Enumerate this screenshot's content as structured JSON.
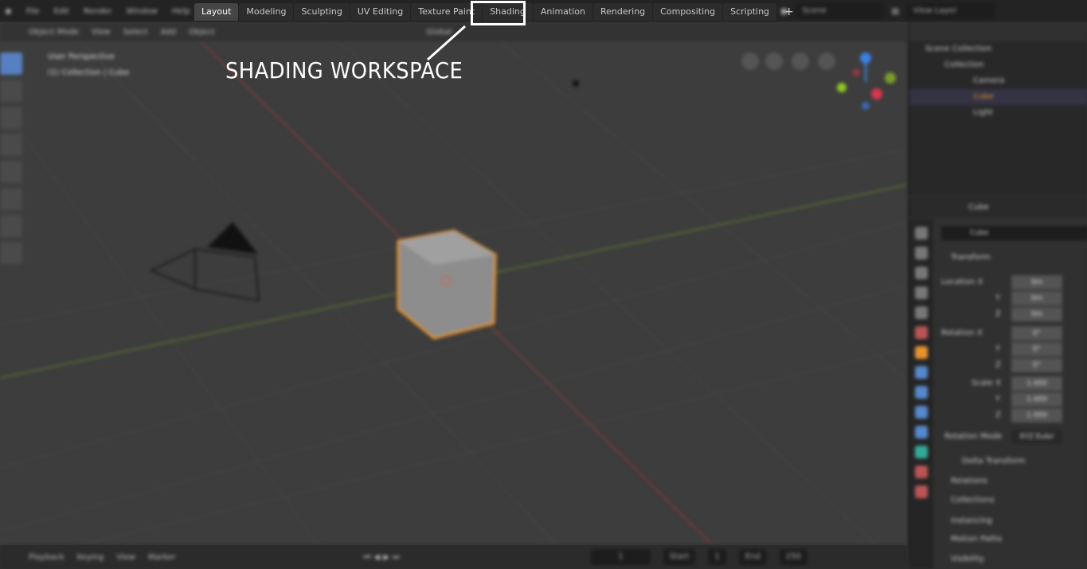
{
  "menu": [
    "File",
    "Edit",
    "Render",
    "Window",
    "Help"
  ],
  "workspace_tabs": [
    "Layout",
    "Modeling",
    "Sculpting",
    "UV Editing",
    "Texture Paint",
    "Shading",
    "Animation",
    "Rendering",
    "Compositing",
    "Scripting"
  ],
  "add_tab": "+",
  "active_tab": "Layout",
  "scene": "Scene",
  "view_layer": "View Layer",
  "viewport_header": {
    "mode": "Object Mode",
    "menus": [
      "View",
      "Select",
      "Add",
      "Object"
    ],
    "orientation": "Global"
  },
  "viewport_info": {
    "line1": "User Perspective",
    "line2": "(1) Collection | Cube"
  },
  "outliner": {
    "items": [
      "Scene Collection",
      "Collection",
      "Camera",
      "Cube",
      "Light"
    ]
  },
  "properties": {
    "object_name": "Cube",
    "data_name": "Cube",
    "transform_label": "Transform",
    "rows": [
      {
        "label": "Location X",
        "value": "0m"
      },
      {
        "label": "Y",
        "value": "0m"
      },
      {
        "label": "Z",
        "value": "0m"
      },
      {
        "label": "Rotation X",
        "value": "0°"
      },
      {
        "label": "Y",
        "value": "0°"
      },
      {
        "label": "Z",
        "value": "0°"
      },
      {
        "label": "Scale X",
        "value": "1.000"
      },
      {
        "label": "Y",
        "value": "1.000"
      },
      {
        "label": "Z",
        "value": "1.000"
      }
    ],
    "rotation_mode_label": "Rotation Mode",
    "rotation_mode": "XYZ Euler",
    "delta": "Delta Transform",
    "sections": [
      "Relations",
      "Collections",
      "Instancing",
      "Motion Paths",
      "Visibility"
    ]
  },
  "timeline": {
    "menus": [
      "Playback",
      "Keying",
      "View",
      "Marker"
    ],
    "current_frame": "1",
    "start_label": "Start",
    "start": "1",
    "end_label": "End",
    "end": "250"
  },
  "annotation": {
    "text": "SHADING WORKSPACE",
    "color": "#ffffff"
  }
}
